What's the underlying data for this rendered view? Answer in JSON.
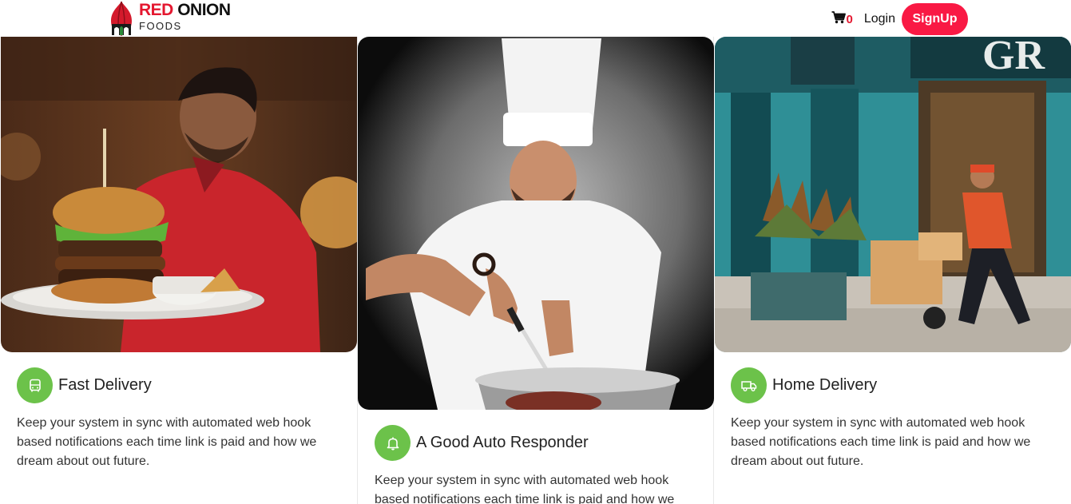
{
  "header": {
    "logo": {
      "word1": "RED",
      "word2": "ONION",
      "sub": "FOODS"
    },
    "cart": {
      "icon": "cart-icon",
      "count": "0"
    },
    "login_label": "Login",
    "signup_label": "SignUp"
  },
  "colors": {
    "brand_red": "#e4172f",
    "signup_bg": "#f91944",
    "badge_green": "#6cc24a"
  },
  "cards": [
    {
      "image": "waiter-holding-burger-photo",
      "icon": "bus-icon",
      "title": "Fast Delivery",
      "description": "Keep your system in sync with automated web hook based notifications each time link is paid and how we dream about out future."
    },
    {
      "image": "chef-cutting-meat-photo",
      "icon": "bell-icon",
      "title": "A Good Auto Responder",
      "description": "Keep your system in sync with automated web hook based notifications each time link is paid and how we dream about out future."
    },
    {
      "image": "courier-hand-truck-storefront-photo",
      "icon": "truck-icon",
      "title": "Home Delivery",
      "description": "Keep your system in sync with automated web hook based notifications each time link is paid and how we dream about out future."
    }
  ]
}
